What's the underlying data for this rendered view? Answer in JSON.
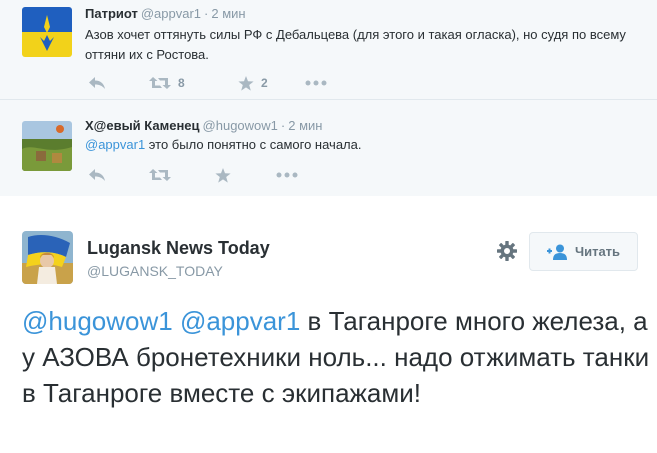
{
  "replies": [
    {
      "name": "Патриот",
      "screen_name": "@appvar1",
      "dot": "·",
      "time": "2 мин",
      "text": "Азов хочет оттянуть силы РФ с Дебальцева (для этого и такая огласка), но судя по всему оттяни их с Ростова.",
      "retweet_count": "8",
      "favorite_count": "2"
    },
    {
      "name": "Х@евый Каменец",
      "screen_name": "@hugowow1",
      "dot": "·",
      "time": "2 мин",
      "mention": "@appvar1",
      "text": " это было понятно с самого начала."
    }
  ],
  "main_tweet": {
    "name": "Lugansk News Today",
    "screen_name": "@LUGANSK_TODAY",
    "follow_label": "Читать",
    "mentions": [
      "@hugowow1",
      "@appvar1"
    ],
    "text": " в Таганроге много железа, а у АЗОВА бронетехники ноль... надо отжимать танки в Таганроге вместе с экипажами!"
  },
  "colors": {
    "link": "#3b94d9",
    "muted": "#8899a6",
    "icon": "#aab8c2",
    "reply_bg": "#f5f8fa"
  },
  "icons": [
    "reply-icon",
    "retweet-icon",
    "favorite-icon",
    "more-icon",
    "gear-icon",
    "follow-icon"
  ]
}
